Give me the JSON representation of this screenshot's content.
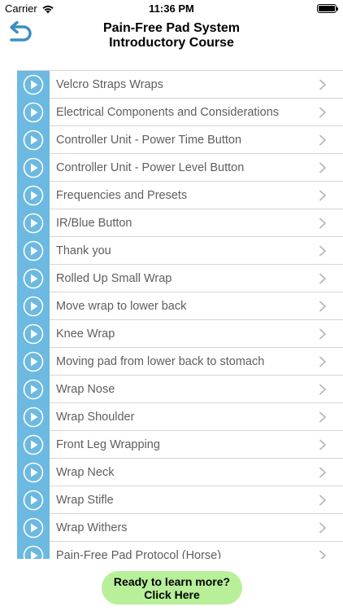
{
  "status_bar": {
    "carrier": "Carrier",
    "time": "11:36 PM"
  },
  "nav": {
    "title_line1": "Pain-Free Pad System",
    "title_line2": "Introductory Course",
    "back_icon": "back-arrow-icon"
  },
  "colors": {
    "thumb": "#6cb9e1",
    "back_icon": "#3d8fc2",
    "cta": "#b7f099"
  },
  "list": {
    "items": [
      {
        "label": "Velcro Straps Wraps"
      },
      {
        "label": "Electrical Components and Considerations"
      },
      {
        "label": "Controller Unit - Power Time Button"
      },
      {
        "label": "Controller Unit - Power Level Button"
      },
      {
        "label": "Frequencies and Presets"
      },
      {
        "label": "IR/Blue Button"
      },
      {
        "label": "Thank you"
      },
      {
        "label": "Rolled Up Small Wrap"
      },
      {
        "label": "Move wrap to lower back"
      },
      {
        "label": "Knee Wrap"
      },
      {
        "label": "Moving pad from lower back to stomach"
      },
      {
        "label": "Wrap Nose"
      },
      {
        "label": "Wrap Shoulder"
      },
      {
        "label": "Front Leg Wrapping"
      },
      {
        "label": "Wrap Neck"
      },
      {
        "label": "Wrap Stifle"
      },
      {
        "label": "Wrap Withers"
      },
      {
        "label": "Pain-Free Pad Protocol (Horse)"
      }
    ]
  },
  "cta": {
    "line1": "Ready to learn more?",
    "line2": "Click Here"
  }
}
